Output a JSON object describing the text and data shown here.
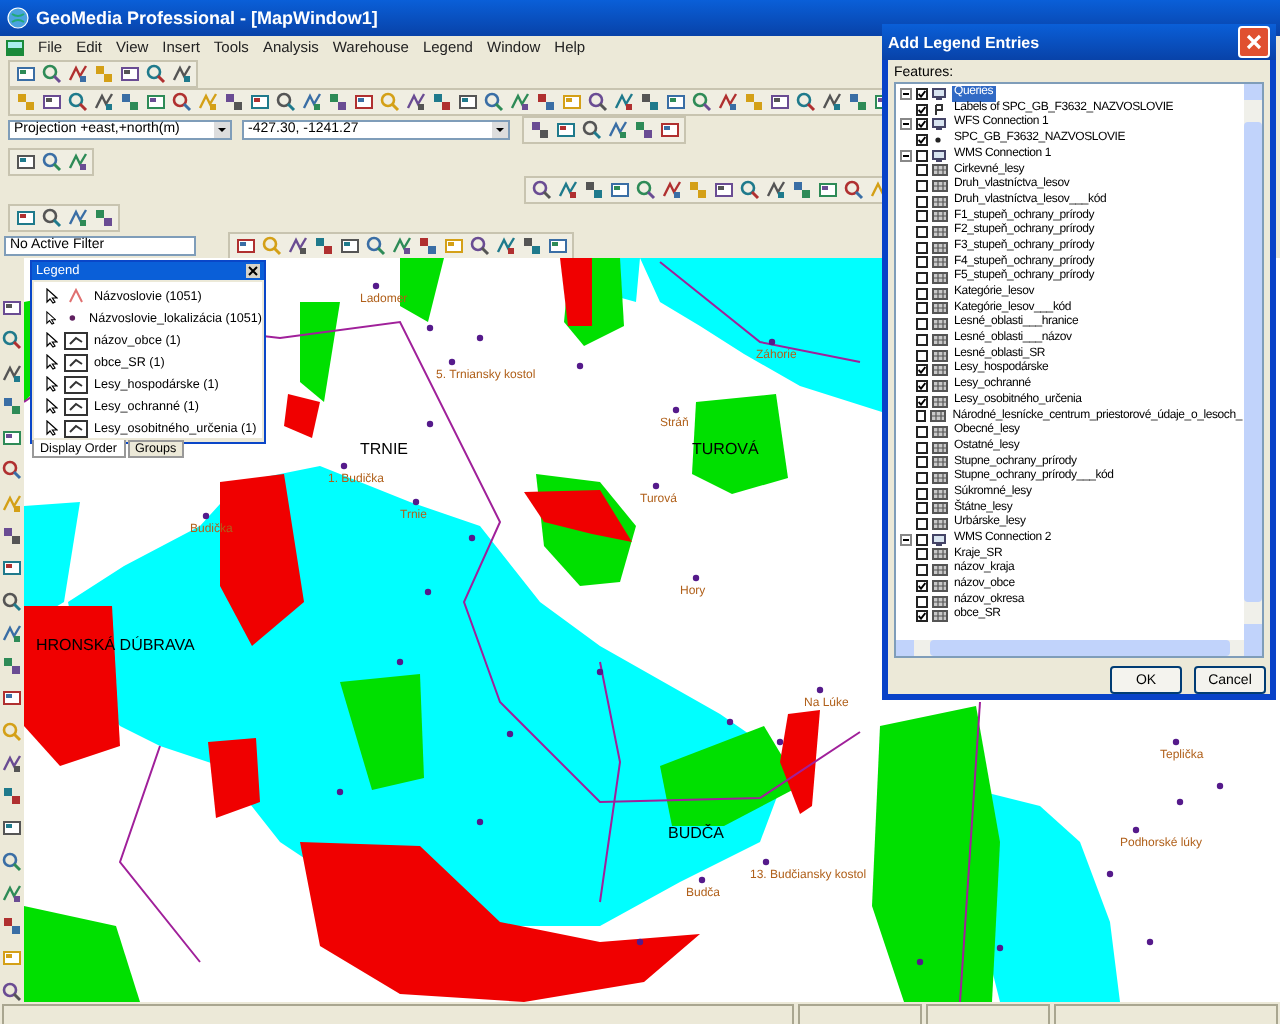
{
  "window": {
    "title": "GeoMedia Professional - [MapWindow1]"
  },
  "menu": [
    "File",
    "Edit",
    "View",
    "Insert",
    "Tools",
    "Analysis",
    "Warehouse",
    "Legend",
    "Window",
    "Help"
  ],
  "toolbar": {
    "projection": "Projection +east,+north(m)",
    "coordinates": "-427.30, -1241.27",
    "filter": "No Active Filter"
  },
  "legend": {
    "title": "Legend",
    "items": [
      {
        "label": "Názvoslovie (1051)",
        "kind": "label"
      },
      {
        "label": "Názvoslovie_lokalizácia (1051)",
        "kind": "point"
      },
      {
        "label": "názov_obce (1)",
        "kind": "area"
      },
      {
        "label": "obce_SR (1)",
        "kind": "area"
      },
      {
        "label": "Lesy_hospodárske (1)",
        "kind": "area"
      },
      {
        "label": "Lesy_ochranné (1)",
        "kind": "area"
      },
      {
        "label": "Lesy_osobitného_určenia (1)",
        "kind": "area"
      }
    ],
    "tabs": [
      {
        "label": "Display Order",
        "selected": true
      },
      {
        "label": "Groups",
        "selected": false
      }
    ]
  },
  "map": {
    "labels": [
      {
        "text": "Ladomer",
        "kind": "place"
      },
      {
        "text": "Záhorie",
        "kind": "place"
      },
      {
        "text": "5. Trniansky kostol",
        "kind": "place"
      },
      {
        "text": "Stráň",
        "kind": "place"
      },
      {
        "text": "TRNIE",
        "kind": "region"
      },
      {
        "text": "TUROVÁ",
        "kind": "region"
      },
      {
        "text": "1. Budička",
        "kind": "place"
      },
      {
        "text": "Turová",
        "kind": "place"
      },
      {
        "text": "Trnie",
        "kind": "place"
      },
      {
        "text": "Budička",
        "kind": "place"
      },
      {
        "text": "Hory",
        "kind": "place"
      },
      {
        "text": "HRONSKÁ DÚBRAVA",
        "kind": "region"
      },
      {
        "text": "Na Lúke",
        "kind": "place"
      },
      {
        "text": "Teplička",
        "kind": "place"
      },
      {
        "text": "BUDČA",
        "kind": "region"
      },
      {
        "text": "Podhorské lúky",
        "kind": "place"
      },
      {
        "text": "13. Budčiansky kostol",
        "kind": "place"
      },
      {
        "text": "Budča",
        "kind": "place"
      }
    ]
  },
  "dialog": {
    "title": "Add Legend Entries",
    "features_label": "Features:",
    "buttons": [
      "OK",
      "Cancel"
    ],
    "tree": [
      {
        "label": "Queries",
        "checked": true,
        "expanded": true,
        "selected": true,
        "children": [
          {
            "label": "Labels of SPC_GB_F3632_NAZVOSLOVIE",
            "checked": true,
            "kind": "label",
            "selected": false
          }
        ]
      },
      {
        "label": "WFS Connection 1",
        "checked": true,
        "expanded": true,
        "selected": false,
        "children": [
          {
            "label": "SPC_GB_F3632_NAZVOSLOVIE",
            "checked": true,
            "kind": "point",
            "selected": false
          }
        ]
      },
      {
        "label": "WMS Connection 1",
        "checked": false,
        "expanded": true,
        "selected": false,
        "children": [
          {
            "label": "Cirkevné_lesy",
            "checked": false,
            "kind": "raster",
            "selected": false
          },
          {
            "label": "Druh_vlastníctva_lesov",
            "checked": false,
            "kind": "raster",
            "selected": false
          },
          {
            "label": "Druh_vlastníctva_lesov___kód",
            "checked": false,
            "kind": "raster",
            "selected": false
          },
          {
            "label": "F1_stupeň_ochrany_prírody",
            "checked": false,
            "kind": "raster",
            "selected": false
          },
          {
            "label": "F2_stupeň_ochrany_prírody",
            "checked": false,
            "kind": "raster",
            "selected": false
          },
          {
            "label": "F3_stupeň_ochrany_prírody",
            "checked": false,
            "kind": "raster",
            "selected": false
          },
          {
            "label": "F4_stupeň_ochrany_prírody",
            "checked": false,
            "kind": "raster",
            "selected": false
          },
          {
            "label": "F5_stupeň_ochrany_prírody",
            "checked": false,
            "kind": "raster",
            "selected": false
          },
          {
            "label": "Kategórie_lesov",
            "checked": false,
            "kind": "raster",
            "selected": false
          },
          {
            "label": "Kategórie_lesov___kód",
            "checked": false,
            "kind": "raster",
            "selected": false
          },
          {
            "label": "Lesné_oblasti___hranice",
            "checked": false,
            "kind": "raster",
            "selected": false
          },
          {
            "label": "Lesné_oblasti___názov",
            "checked": false,
            "kind": "raster",
            "selected": false
          },
          {
            "label": "Lesné_oblasti_SR",
            "checked": false,
            "kind": "raster",
            "selected": false
          },
          {
            "label": "Lesy_hospodárske",
            "checked": true,
            "kind": "raster",
            "selected": false
          },
          {
            "label": "Lesy_ochranné",
            "checked": true,
            "kind": "raster",
            "selected": false
          },
          {
            "label": "Lesy_osobitného_určenia",
            "checked": true,
            "kind": "raster",
            "selected": false
          },
          {
            "label": "Národné_lesnícke_centrum_priestorové_údaje_o_lesoch_",
            "checked": false,
            "kind": "raster",
            "selected": false
          },
          {
            "label": "Obecné_lesy",
            "checked": false,
            "kind": "raster",
            "selected": false
          },
          {
            "label": "Ostatné_lesy",
            "checked": false,
            "kind": "raster",
            "selected": false
          },
          {
            "label": "Stupne_ochrany_prírody",
            "checked": false,
            "kind": "raster",
            "selected": false
          },
          {
            "label": "Stupne_ochrany_prírody___kód",
            "checked": false,
            "kind": "raster",
            "selected": false
          },
          {
            "label": "Súkromné_lesy",
            "checked": false,
            "kind": "raster",
            "selected": false
          },
          {
            "label": "Štátne_lesy",
            "checked": false,
            "kind": "raster",
            "selected": false
          },
          {
            "label": "Urbárske_lesy",
            "checked": false,
            "kind": "raster",
            "selected": false
          }
        ]
      },
      {
        "label": "WMS Connection 2",
        "checked": false,
        "expanded": true,
        "selected": false,
        "children": [
          {
            "label": "Kraje_SR",
            "checked": false,
            "kind": "raster",
            "selected": false
          },
          {
            "label": "názov_kraja",
            "checked": false,
            "kind": "raster",
            "selected": false
          },
          {
            "label": "názov_obce",
            "checked": true,
            "kind": "raster",
            "selected": false
          },
          {
            "label": "názov_okresa",
            "checked": false,
            "kind": "raster",
            "selected": false
          },
          {
            "label": "obce_SR",
            "checked": true,
            "kind": "raster",
            "selected": false
          }
        ]
      }
    ]
  }
}
